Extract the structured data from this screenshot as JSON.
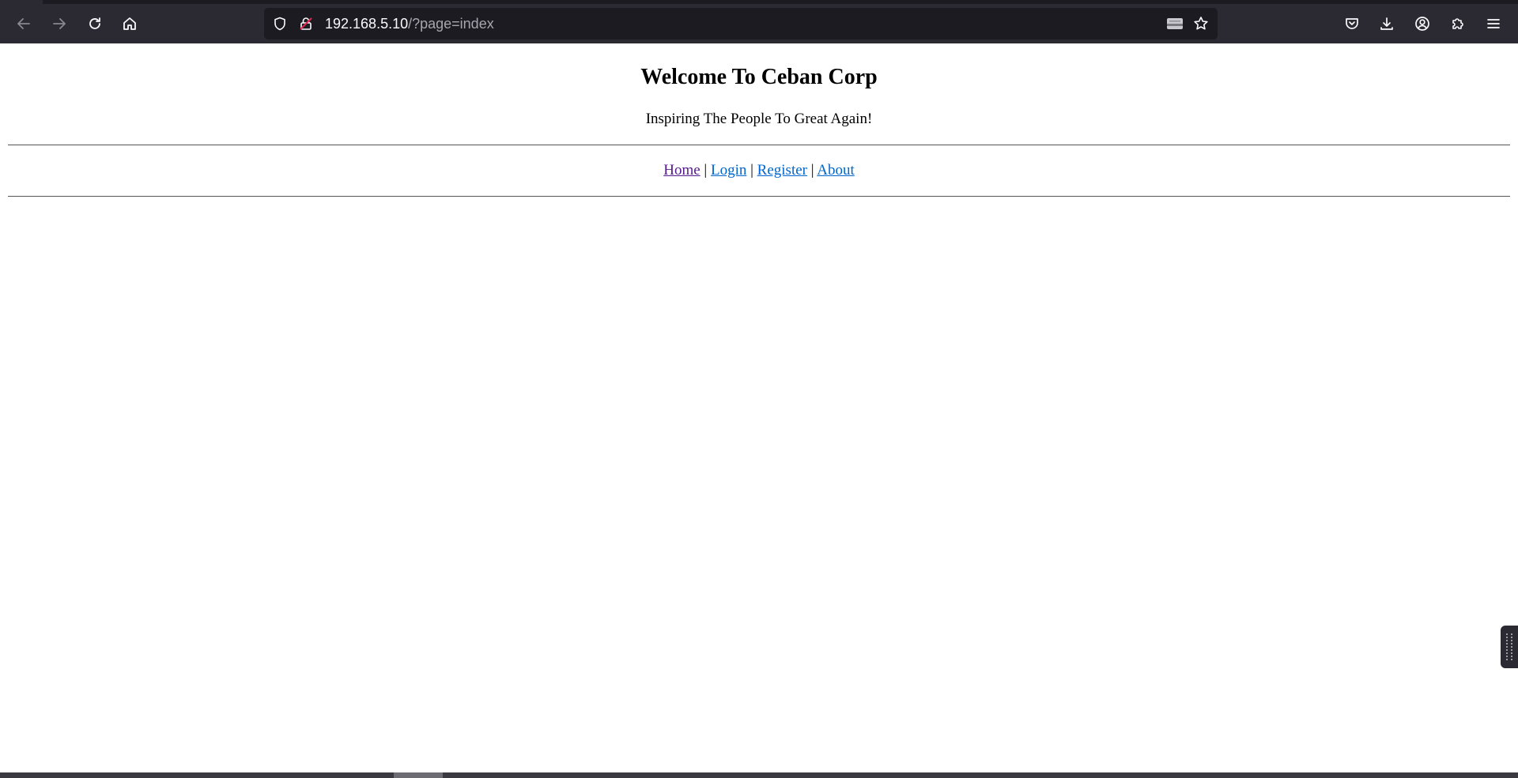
{
  "browser": {
    "url_host": "192.168.5.10",
    "url_path": "/?page=index",
    "icons": {
      "back": "arrow-left-icon",
      "forward": "arrow-right-icon",
      "reload": "reload-icon",
      "home": "home-icon",
      "shield": "shield-icon",
      "insecure_lock": "insecure-lock-icon",
      "reader": "reader-icon",
      "bookmark": "star-icon",
      "pocket": "pocket-icon",
      "downloads": "download-icon",
      "account": "account-icon",
      "extensions": "puzzle-icon",
      "menu": "hamburger-icon"
    }
  },
  "page": {
    "title": "Welcome To Ceban Corp",
    "subtitle": "Inspiring The People To Great Again!",
    "nav": [
      {
        "label": "Home"
      },
      {
        "label": "Login"
      },
      {
        "label": "Register"
      },
      {
        "label": "About"
      }
    ],
    "separator": "|"
  },
  "colors": {
    "visited_link": "#551a8b",
    "link": "#0066cc",
    "chrome_bg": "#2b2a33",
    "urlbar_bg": "#1c1b22"
  }
}
